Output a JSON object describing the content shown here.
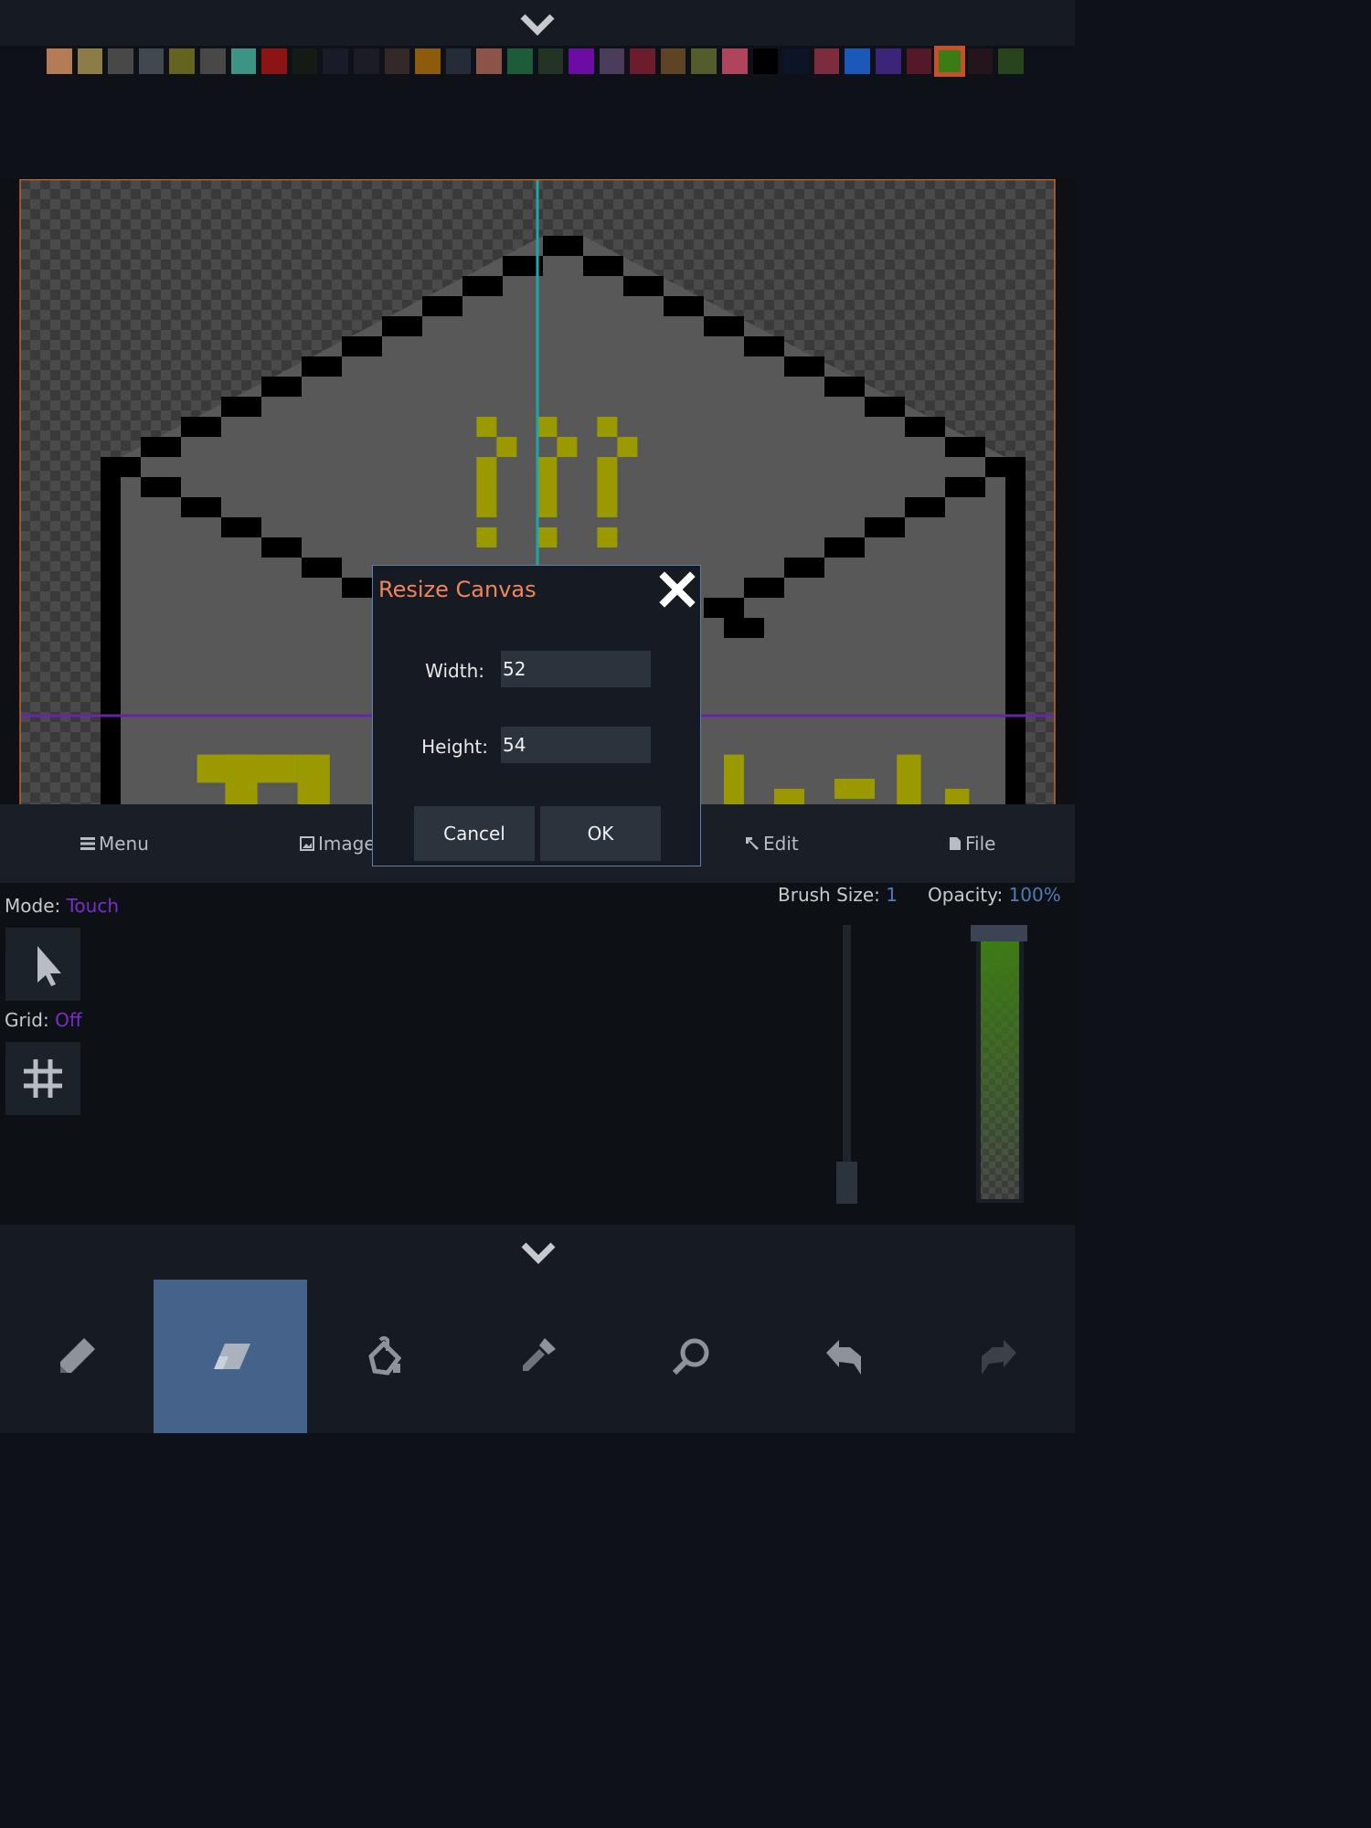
{
  "palette": {
    "colors": [
      "#b47c54",
      "#8c7c48",
      "#484848",
      "#404850",
      "#646420",
      "#484848",
      "#3c9484",
      "#8c1414",
      "#141a14",
      "#181c28",
      "#1c1c24",
      "#342828",
      "#8c5c0c",
      "#242c38",
      "#8c5448",
      "#1c5c38",
      "#243424",
      "#6c0ca4",
      "#4c3c5c",
      "#6c1c2c",
      "#5c4424",
      "#545c2c",
      "#b0445c",
      "#000000",
      "#0c1428",
      "#7c2c3c",
      "#1c58b8",
      "#3c2478",
      "#541828",
      "#3c7c14",
      "#24141c",
      "#28441c"
    ],
    "selected_index": 29,
    "selected_border": "#c4502c"
  },
  "canvas": {
    "bg_pattern": "checker",
    "fill_color": "#585858",
    "outline_color": "#000000",
    "accent_color": "#9a9a00",
    "v_guide_color": "#1fa6a6",
    "h_guide_color": "#6a22b4",
    "border_color": "#c2662a"
  },
  "menu": {
    "menu_label": "Menu",
    "image_label": "Image",
    "edit_label": "Edit",
    "file_label": "File"
  },
  "options": {
    "mode_label": "Mode:",
    "mode_value": "Touch",
    "grid_label": "Grid:",
    "grid_value": "Off",
    "brush_label": "Brush Size:",
    "brush_value": "1",
    "opacity_label": "Opacity:",
    "opacity_value": "100%",
    "opacity_fraction": 1.0,
    "brush_fraction": 0.0
  },
  "tools": {
    "items": [
      "pencil-icon",
      "eraser-icon",
      "fill-bucket-icon",
      "eyedropper-icon",
      "zoom-icon",
      "undo-icon",
      "redo-icon"
    ],
    "active_index": 1
  },
  "dialog": {
    "title": "Resize Canvas",
    "width_label": "Width:",
    "width_value": "52",
    "height_label": "Height:",
    "height_value": "54",
    "cancel_label": "Cancel",
    "ok_label": "OK"
  }
}
